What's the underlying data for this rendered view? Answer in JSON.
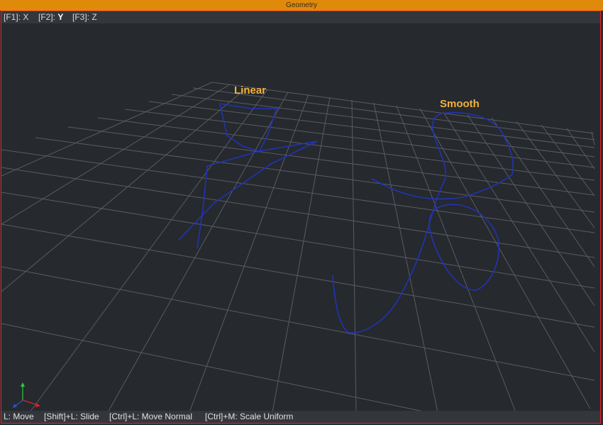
{
  "window": {
    "title": "Geometry"
  },
  "axis_toggles": [
    {
      "key": "[F1]:",
      "axis": "X"
    },
    {
      "key": "[F2]:",
      "axis": "Y"
    },
    {
      "key": "[F3]:",
      "axis": "Z"
    }
  ],
  "scene": {
    "curves": [
      {
        "label": "Linear",
        "color": "#1f2ea8"
      },
      {
        "label": "Smooth",
        "color": "#1f2ea8"
      }
    ],
    "grid_color": "#6a6d72",
    "gizmo": {
      "x_color": "#d3262b",
      "y_color": "#2ecc40",
      "z_color": "#2a53d6"
    }
  },
  "status_hints": [
    "L: Move",
    "[Shift]+L: Slide",
    "[Ctrl]+L: Move Normal",
    "[Ctrl]+M: Scale Uniform"
  ]
}
